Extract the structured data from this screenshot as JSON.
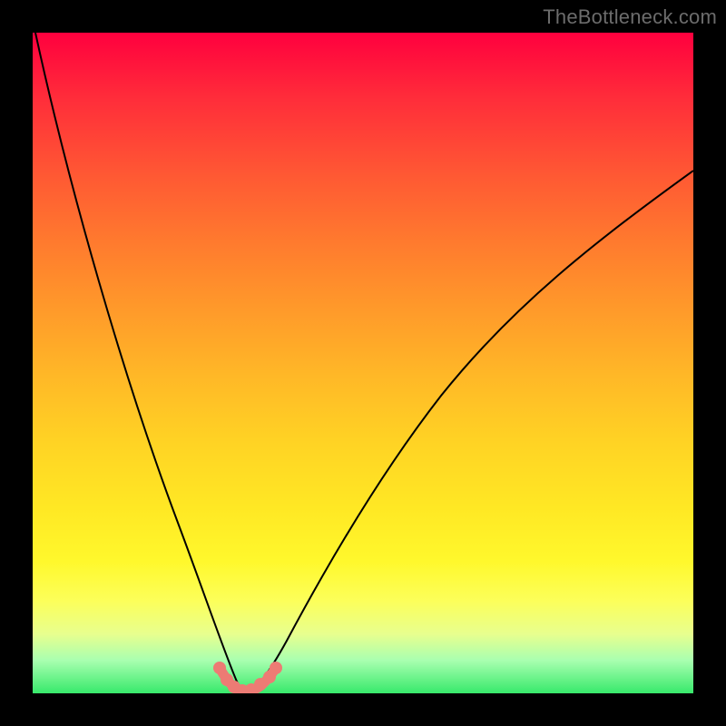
{
  "watermark": "TheBottleneck.com",
  "chart_data": {
    "type": "line",
    "title": "",
    "xlabel": "",
    "ylabel": "",
    "xlim": [
      0,
      1
    ],
    "ylim": [
      0,
      1
    ],
    "series": [
      {
        "name": "left-branch",
        "x": [
          0.005,
          0.03,
          0.06,
          0.09,
          0.12,
          0.15,
          0.18,
          0.21,
          0.24,
          0.26,
          0.28,
          0.295,
          0.305,
          0.315
        ],
        "y": [
          1.0,
          0.885,
          0.768,
          0.652,
          0.537,
          0.425,
          0.315,
          0.212,
          0.12,
          0.062,
          0.026,
          0.01,
          0.004,
          0.002
        ]
      },
      {
        "name": "right-branch",
        "x": [
          0.315,
          0.33,
          0.355,
          0.39,
          0.44,
          0.5,
          0.56,
          0.62,
          0.68,
          0.74,
          0.8,
          0.86,
          0.92,
          0.98,
          1.0
        ],
        "y": [
          0.002,
          0.006,
          0.02,
          0.06,
          0.145,
          0.255,
          0.355,
          0.44,
          0.515,
          0.58,
          0.638,
          0.69,
          0.735,
          0.775,
          0.79
        ]
      },
      {
        "name": "salmon-arc",
        "x": [
          0.281,
          0.288,
          0.297,
          0.307,
          0.318,
          0.33,
          0.343,
          0.356,
          0.368
        ],
        "y": [
          0.035,
          0.02,
          0.01,
          0.004,
          0.002,
          0.004,
          0.01,
          0.02,
          0.035
        ]
      }
    ],
    "markers": {
      "name": "salmon-dots",
      "x": [
        0.283,
        0.293,
        0.305,
        0.318,
        0.331,
        0.345,
        0.358,
        0.368
      ],
      "y": [
        0.033,
        0.016,
        0.006,
        0.002,
        0.003,
        0.009,
        0.02,
        0.034
      ]
    },
    "background": "rainbow-vertical-gradient",
    "colors": {
      "curve": "#000000",
      "markers": "#ed7b74",
      "frame": "#000000"
    }
  }
}
